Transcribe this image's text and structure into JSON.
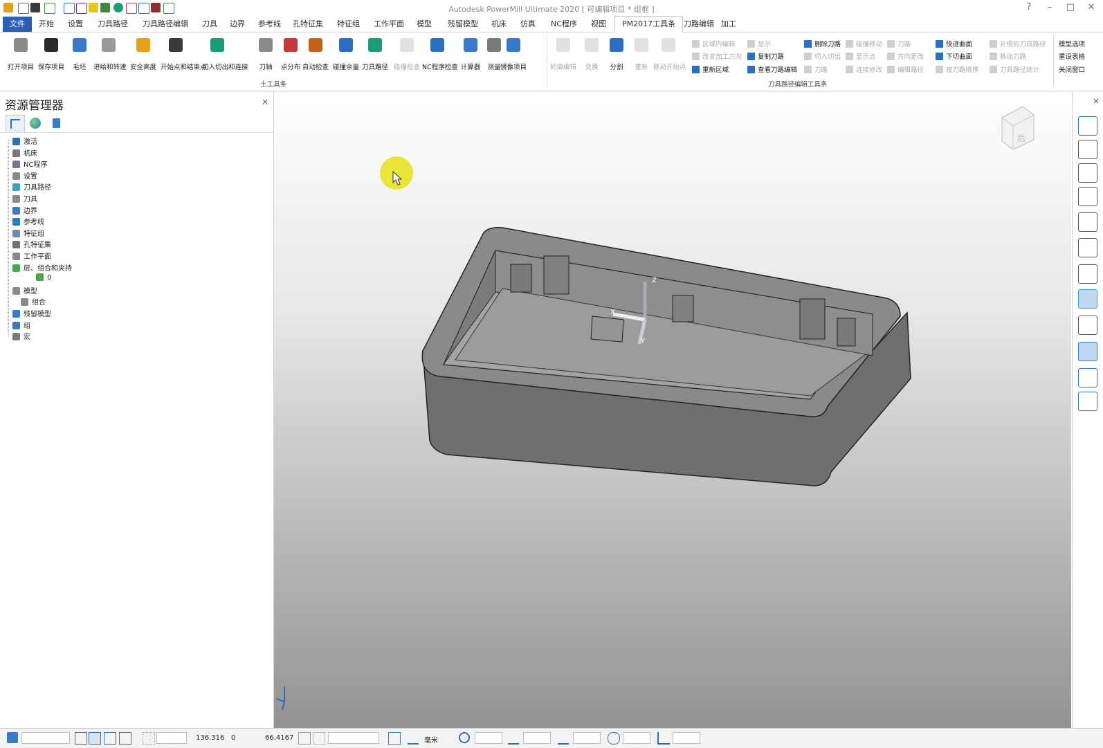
{
  "window": {
    "title": "Autodesk PowerMill Ultimate 2020   [ 可编辑项目 * 组框 ]",
    "help": "?",
    "minimize": "–",
    "maximize": "□",
    "close": "✕"
  },
  "menu_tabs": [
    "文件",
    "开始",
    "设置",
    "刀具路径",
    "刀具路径编辑",
    "刀具",
    "边界",
    "参考线",
    "孔特征集",
    "特征组",
    "工作平面",
    "模型",
    "残留模型",
    "机床",
    "仿真",
    "NC程序",
    "视图",
    "PM2017工具条",
    "刀路编辑",
    "加工"
  ],
  "active_tab": "PM2017工具条",
  "ribbon": {
    "group1_label": "土工具条",
    "group2_label": "刀具路径编辑工具条",
    "buttons": [
      {
        "label": "打开项目",
        "enabled": true
      },
      {
        "label": "保存项目",
        "enabled": true
      },
      {
        "label": "毛坯",
        "enabled": true
      },
      {
        "label": "进给和转速",
        "enabled": true
      },
      {
        "label": "安全高度",
        "enabled": true
      },
      {
        "label": "开始点和结束点",
        "enabled": true
      },
      {
        "label": "切入切出和连接",
        "enabled": true
      },
      {
        "label": "刀轴",
        "enabled": true
      },
      {
        "label": "点分布",
        "enabled": true
      },
      {
        "label": "自动检查",
        "enabled": true
      },
      {
        "label": "碰撞余量",
        "enabled": true
      },
      {
        "label": "刀具路径",
        "enabled": true
      },
      {
        "label": "碰撞检查",
        "enabled": false
      },
      {
        "label": "NC程序检查",
        "enabled": true
      },
      {
        "label": "计算器",
        "enabled": true
      },
      {
        "label": "测量",
        "enabled": true
      },
      {
        "label": "镜像项目",
        "enabled": true
      },
      {
        "label": "轮廓编辑",
        "enabled": false
      },
      {
        "label": "变换",
        "enabled": false
      },
      {
        "label": "分割",
        "enabled": true
      },
      {
        "label": "重新",
        "enabled": false
      },
      {
        "label": "移动开始点",
        "enabled": false
      }
    ],
    "small_items": [
      {
        "label": "区域内编辑",
        "enabled": false
      },
      {
        "label": "改变加工方向",
        "enabled": false
      },
      {
        "label": "重新区域",
        "enabled": true
      },
      {
        "label": "显示",
        "enabled": false
      },
      {
        "label": "复制刀路",
        "enabled": true
      },
      {
        "label": "查看刀路编辑",
        "enabled": true
      },
      {
        "label": "删除刀路",
        "enabled": true
      },
      {
        "label": "切入切出",
        "enabled": false
      },
      {
        "label": "刀路",
        "enabled": false
      },
      {
        "label": "碰撞移动",
        "enabled": false
      },
      {
        "label": "显示点",
        "enabled": false
      },
      {
        "label": "连接修改",
        "enabled": false
      },
      {
        "label": "刀路",
        "enabled": false
      },
      {
        "label": "方向更改",
        "enabled": false
      },
      {
        "label": "编辑路径",
        "enabled": false
      },
      {
        "label": "快进曲面",
        "enabled": true
      },
      {
        "label": "下切曲面",
        "enabled": true
      },
      {
        "label": "按刀路顺序",
        "enabled": false
      },
      {
        "label": "补偿的刀具路径",
        "enabled": false
      },
      {
        "label": "移动刀路",
        "enabled": false
      },
      {
        "label": "刀具路径统计",
        "enabled": false
      },
      {
        "label": "模型选项",
        "enabled": true
      },
      {
        "label": "重设表格",
        "enabled": true
      },
      {
        "label": "关闭窗口",
        "enabled": true
      }
    ]
  },
  "explorer": {
    "title": "资源管理器",
    "close": "×",
    "tree": [
      {
        "label": "激活",
        "color": "#2c6fbf"
      },
      {
        "label": "机床",
        "color": "#7a7a7a"
      },
      {
        "label": "NC程序",
        "color": "#6b7a8c"
      },
      {
        "label": "设置",
        "color": "#8a8a8a"
      },
      {
        "label": "刀具路径",
        "color": "#3aa0c8"
      },
      {
        "label": "刀具",
        "color": "#8a8a8a"
      },
      {
        "label": "边界",
        "color": "#3a78c8"
      },
      {
        "label": "参考线",
        "color": "#2a7fc0"
      },
      {
        "label": "特征组",
        "color": "#6a8aa8"
      },
      {
        "label": "孔特征集",
        "color": "#707070"
      },
      {
        "label": "工作平面",
        "color": "#8a8a8a"
      },
      {
        "label": "层、组合和夹持",
        "color": "#4aa84a"
      },
      {
        "label": "0",
        "color": "#4aa84a"
      },
      {
        "label": "模型",
        "color": "#8a8a8a"
      },
      {
        "label": "组合",
        "color": "#8a8a8a"
      },
      {
        "label": "残留模型",
        "color": "#3a7ac8"
      },
      {
        "label": "组",
        "color": "#3a78b8"
      },
      {
        "label": "宏",
        "color": "#7a7a7a"
      }
    ]
  },
  "viewport": {
    "axis_labels": {
      "z": "Z",
      "x": "X",
      "y": "Y"
    },
    "viewcube_label": "后"
  },
  "status": {
    "x": "136.316",
    "y": "0",
    "z": "66.4167",
    "units": "毫米"
  }
}
